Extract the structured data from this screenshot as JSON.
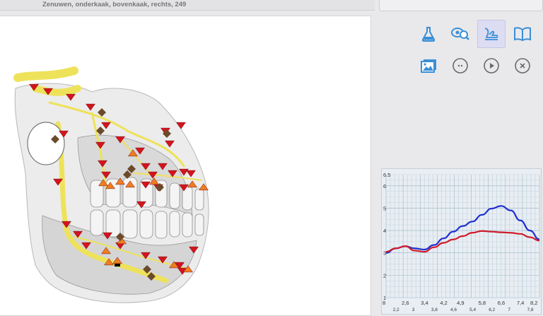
{
  "header": {
    "title": "Zenuwen, onderkaak, bovenkaak, rechts, 249"
  },
  "toolbar": {
    "buttons": [
      {
        "name": "flask",
        "icon": "flask-icon",
        "active": false
      },
      {
        "name": "search-eye",
        "icon": "search-eye-icon",
        "active": false
      },
      {
        "name": "pointer-hand",
        "icon": "pointer-hand-icon",
        "active": true
      },
      {
        "name": "book",
        "icon": "open-book-icon",
        "active": false
      },
      {
        "name": "images",
        "icon": "photos-icon",
        "active": false
      },
      {
        "name": "more",
        "icon": "more-icon",
        "active": false
      },
      {
        "name": "play",
        "icon": "play-icon",
        "active": false
      },
      {
        "name": "close",
        "icon": "close-icon",
        "active": false
      }
    ],
    "accent_color": "#3b8fd6"
  },
  "illustration": {
    "subject": "jaw-nerves-illustration",
    "nerve_color": "#eee25a",
    "marker_colors": {
      "red_down": "#d3141e",
      "orange_up": "#ef7d22",
      "brown_diamond": "#6b4a2a"
    }
  },
  "chart_data": {
    "type": "line",
    "title": "",
    "xlabel": "",
    "ylabel": "",
    "ylim": [
      1,
      6.5
    ],
    "xlim": [
      1.8,
      8.2
    ],
    "yticks": [
      "6.5",
      "6",
      "5",
      "4",
      "3",
      "2",
      "1"
    ],
    "ytick_values": [
      6.5,
      6,
      5,
      4,
      3,
      2,
      1
    ],
    "xticks_top": [
      "8",
      "2,6",
      "3,4",
      "4,2",
      "4,9",
      "5,8",
      "6,6",
      "7,4",
      "8,2"
    ],
    "xticks_top_values": [
      1.8,
      2.6,
      3.4,
      4.2,
      4.9,
      5.8,
      6.6,
      7.4,
      8.2
    ],
    "xticks_bottom": [
      "2,2",
      "3",
      "3,8",
      "4,6",
      "5,4",
      "6,2",
      "7",
      "7,8"
    ],
    "xticks_bottom_values": [
      2.2,
      3.0,
      3.8,
      4.6,
      5.4,
      6.2,
      7.0,
      7.8
    ],
    "grid": true,
    "series": [
      {
        "color": "#1f2fd0",
        "x": [
          1.8,
          2.2,
          2.6,
          3.0,
          3.4,
          3.8,
          4.2,
          4.6,
          5.0,
          5.4,
          5.8,
          6.2,
          6.6,
          7.0,
          7.4,
          7.8,
          8.2
        ],
        "y": [
          3.0,
          3.2,
          3.3,
          3.2,
          3.15,
          3.35,
          3.65,
          3.95,
          4.2,
          4.4,
          4.7,
          4.98,
          5.1,
          4.9,
          4.45,
          4.0,
          3.6
        ]
      },
      {
        "color": "#d01a2a",
        "x": [
          1.8,
          2.2,
          2.6,
          3.0,
          3.4,
          3.8,
          4.2,
          4.6,
          5.0,
          5.4,
          5.8,
          6.2,
          6.6,
          7.0,
          7.4,
          7.8,
          8.2
        ],
        "y": [
          3.05,
          3.2,
          3.3,
          3.1,
          3.05,
          3.25,
          3.45,
          3.6,
          3.75,
          3.9,
          3.98,
          3.95,
          3.92,
          3.9,
          3.85,
          3.7,
          3.55
        ]
      }
    ]
  }
}
